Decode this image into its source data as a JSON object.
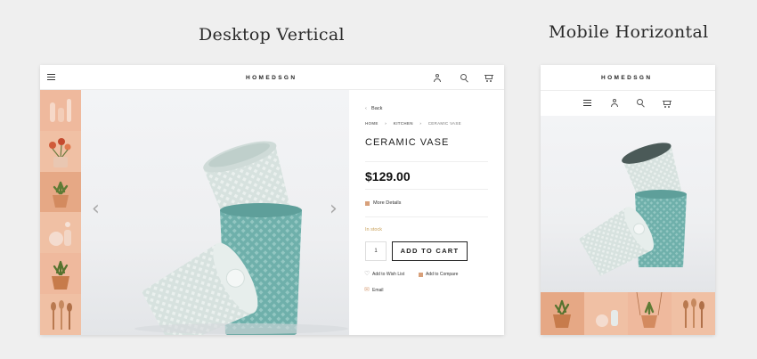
{
  "captions": {
    "desktop": "Desktop Vertical",
    "mobile": "Mobile Horizontal"
  },
  "brand": {
    "logo": "HOMEDSGN"
  },
  "icons": {
    "menu": "hamburger-icon",
    "account": "user-icon",
    "search": "search-icon",
    "cart": "cart-icon",
    "prev": "chevron-left-icon",
    "next": "chevron-right-icon"
  },
  "product": {
    "back": "Back",
    "back_arrow": "‹",
    "breadcrumb": [
      "HOME",
      "KITCHEN",
      "CERAMIC VASE"
    ],
    "breadcrumb_sep": "›",
    "title": "CERAMIC VASE",
    "price": "$129.00",
    "more_details": "More Details",
    "stock": "In stock",
    "quantity": "1",
    "add_to_cart": "ADD TO CART",
    "wishlist": "Add to Wish List",
    "compare": "Add to Compare",
    "email": "Email"
  },
  "glyphs": {
    "prev": "‹",
    "next": "›",
    "heart": "♡",
    "mail": "✉"
  },
  "colors": {
    "thumb_bg": "#efb99d",
    "vase_white": "#dfe7e5",
    "vase_teal": "#7fb8b3",
    "accent": "#d8a07a",
    "stock": "#c9a15a"
  }
}
